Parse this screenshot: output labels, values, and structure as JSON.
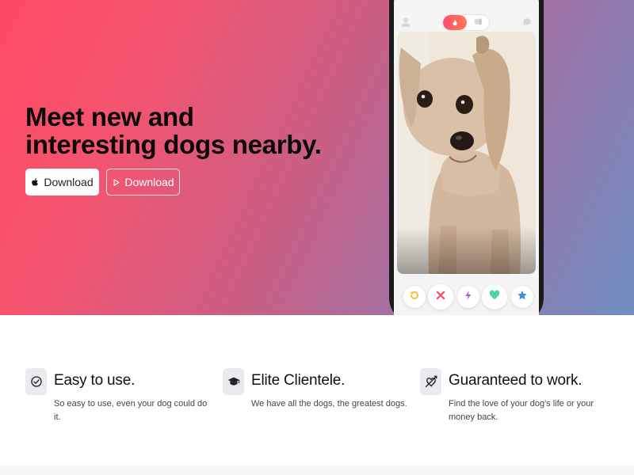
{
  "hero": {
    "title": "Meet new and interesting dogs nearby.",
    "buttons": [
      {
        "label": "Download",
        "icon": "apple-icon"
      },
      {
        "label": "Download",
        "icon": "play-icon"
      }
    ]
  },
  "phone": {
    "card_image": "dog photo",
    "actions": [
      "rewind-icon",
      "nope-icon",
      "boost-icon",
      "like-icon",
      "super-like-icon"
    ]
  },
  "features": [
    {
      "title": "Easy to use.",
      "text": "So easy to use, even your dog could do it.",
      "icon": "check-circle-icon"
    },
    {
      "title": "Elite Clientele.",
      "text": "We have all the dogs, the greatest dogs.",
      "icon": "graduation-cap-icon"
    },
    {
      "title": "Guaranteed to work.",
      "text": "Find the love of your dog's life or your money back.",
      "icon": "heart-arrow-icon"
    }
  ],
  "colors": {
    "gradient_start": "#ff4a63",
    "gradient_end": "#6f8ec2",
    "accent_red": "#fd4e6b",
    "nope": "#fd4e6b",
    "rewind": "#f7b731",
    "boost": "#a55eea",
    "like": "#4fd1a5",
    "super_like": "#3b8ed8"
  }
}
